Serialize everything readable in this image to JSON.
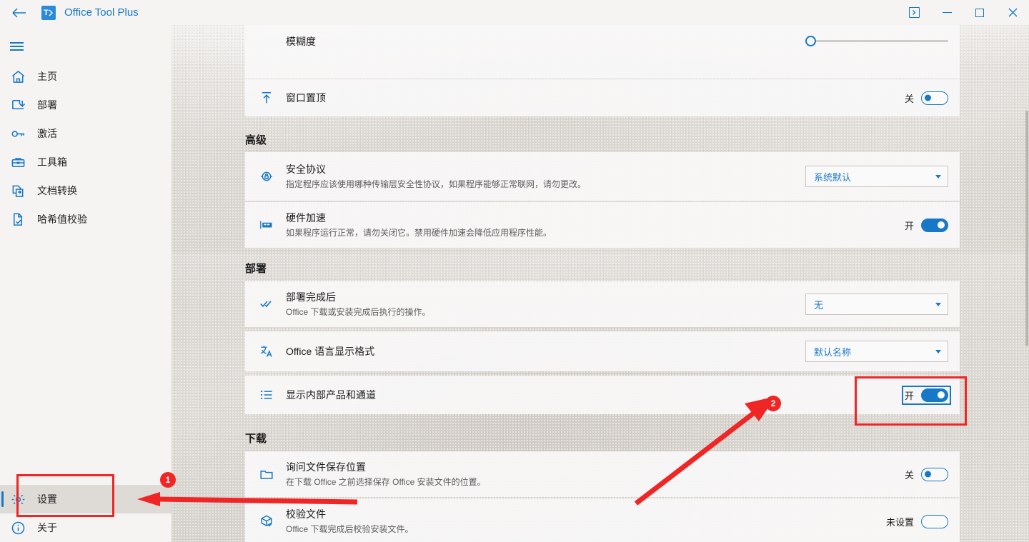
{
  "window": {
    "title": "Office Tool Plus",
    "logo_text": "T",
    "back_icon": "back-arrow-icon",
    "controls": {
      "console": "console-icon",
      "minimize": "minimize-icon",
      "maximize": "maximize-icon",
      "close": "close-icon"
    }
  },
  "sidebar": {
    "menu_icon": "hamburger-icon",
    "items": [
      {
        "label": "主页",
        "icon": "home-icon"
      },
      {
        "label": "部署",
        "icon": "deploy-download-icon"
      },
      {
        "label": "激活",
        "icon": "key-icon"
      },
      {
        "label": "工具箱",
        "icon": "toolbox-icon"
      },
      {
        "label": "文档转换",
        "icon": "document-convert-icon"
      },
      {
        "label": "哈希值校验",
        "icon": "file-check-icon"
      }
    ],
    "bottom_items": [
      {
        "label": "设置",
        "icon": "gear-icon",
        "selected": true
      },
      {
        "label": "关于",
        "icon": "info-icon",
        "selected": false
      }
    ]
  },
  "settings": {
    "blur": {
      "label": "模糊度",
      "slider_value": 0,
      "slider_min": 0,
      "slider_max": 100
    },
    "topmost": {
      "icon": "pin-top-icon",
      "label": "窗口置顶",
      "toggle_label": "关",
      "toggle_state": "off"
    },
    "sections": [
      {
        "title": "高级",
        "rows": [
          {
            "icon": "shield-lock-icon",
            "title": "安全协议",
            "subtitle": "指定程序应该使用哪种传输层安全性协议，如果程序能够正常联网，请勿更改。",
            "control": "dropdown",
            "value": "系统默认"
          },
          {
            "icon": "gpu-chip-icon",
            "title": "硬件加速",
            "subtitle": "如果程序运行正常，请勿关闭它。禁用硬件加速会降低应用程序性能。",
            "control": "toggle",
            "toggle_label": "开",
            "toggle_state": "on"
          }
        ]
      },
      {
        "title": "部署",
        "rows": [
          {
            "icon": "double-check-icon",
            "title": "部署完成后",
            "subtitle": "Office 下载或安装完成后执行的操作。",
            "control": "dropdown",
            "value": "无"
          },
          {
            "icon": "translate-icon",
            "title": "Office 语言显示格式",
            "subtitle": "",
            "control": "dropdown",
            "value": "默认名称"
          },
          {
            "icon": "list-icon",
            "title": "显示内部产品和通道",
            "subtitle": "",
            "control": "toggle",
            "toggle_label": "开",
            "toggle_state": "on",
            "focused": true
          }
        ]
      },
      {
        "title": "下载",
        "rows": [
          {
            "icon": "folder-icon",
            "title": "询问文件保存位置",
            "subtitle": "在下载 Office 之前选择保存 Office 安装文件的位置。",
            "control": "toggle",
            "toggle_label": "关",
            "toggle_state": "off"
          },
          {
            "icon": "package-check-icon",
            "title": "校验文件",
            "subtitle": "Office 下载完成后校验安装文件。",
            "control": "toggle",
            "toggle_label": "未设置",
            "toggle_state": "unset"
          }
        ]
      }
    ]
  },
  "annotations": {
    "color": "#f02525",
    "markers": [
      {
        "number": "1",
        "target": "sidebar-item-settings"
      },
      {
        "number": "2",
        "target": "show-internal-products-toggle"
      }
    ],
    "boxes": [
      {
        "target": "sidebar-item-settings"
      },
      {
        "target": "show-internal-products-toggle"
      }
    ],
    "arrows": [
      {
        "from": "right",
        "to": "sidebar-item-settings"
      },
      {
        "from": "bottom-left",
        "to": "show-internal-products-toggle"
      }
    ]
  }
}
